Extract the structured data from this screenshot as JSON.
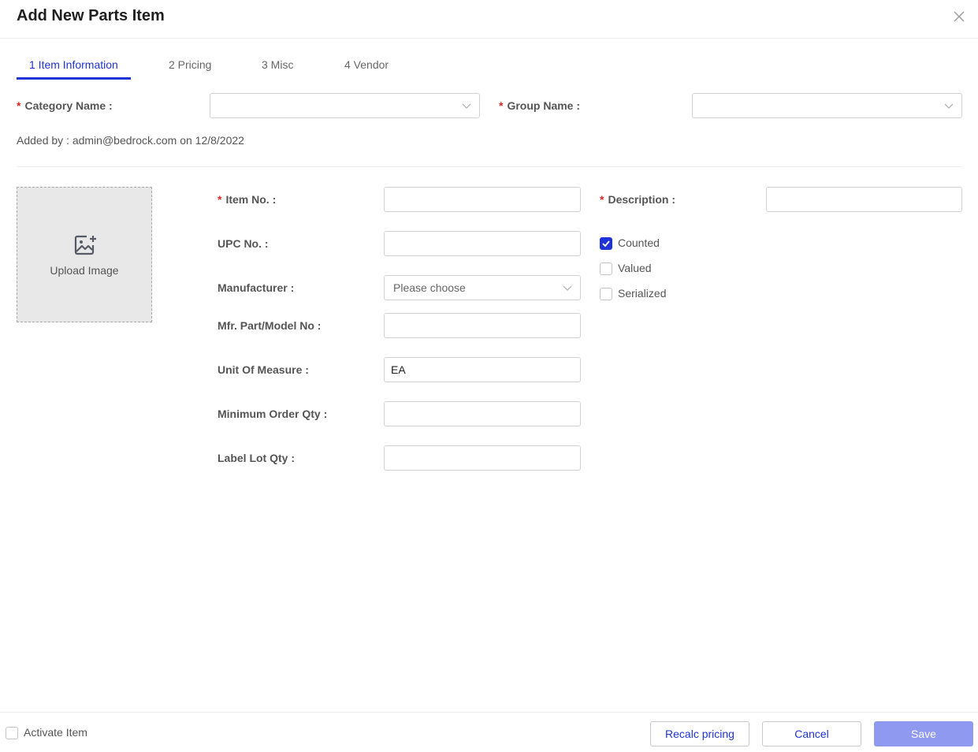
{
  "dialog": {
    "title": "Add New Parts Item"
  },
  "tabs": [
    {
      "label": "1 Item Information",
      "active": true
    },
    {
      "label": "2 Pricing",
      "active": false
    },
    {
      "label": "3 Misc",
      "active": false
    },
    {
      "label": "4 Vendor",
      "active": false
    }
  ],
  "top_fields": {
    "category_label": "Category Name",
    "category_value": "",
    "group_label": "Group Name",
    "group_value": ""
  },
  "added_by": "Added by : admin@bedrock.com on 12/8/2022",
  "upload": {
    "label": "Upload Image",
    "icon": "image-add-icon"
  },
  "form": {
    "item_no": {
      "label": "Item No.",
      "value": ""
    },
    "upc_no": {
      "label": "UPC No.",
      "value": ""
    },
    "manufacturer": {
      "label": "Manufacturer",
      "placeholder": "Please choose"
    },
    "mfr_part": {
      "label": "Mfr. Part/Model No",
      "value": ""
    },
    "unit_of_measure": {
      "label": "Unit Of Measure",
      "value": "EA"
    },
    "min_order_qty": {
      "label": "Minimum Order Qty",
      "value": ""
    },
    "label_lot_qty": {
      "label": "Label Lot Qty",
      "value": ""
    },
    "description": {
      "label": "Description",
      "value": ""
    }
  },
  "checkboxes": [
    {
      "label": "Counted",
      "checked": true
    },
    {
      "label": "Valued",
      "checked": false
    },
    {
      "label": "Serialized",
      "checked": false
    }
  ],
  "footer": {
    "activate_label": "Activate Item",
    "activate_checked": false,
    "recalc_label": "Recalc pricing",
    "cancel_label": "Cancel",
    "save_label": "Save"
  },
  "colors": {
    "accent": "#1f33d6",
    "required": "#e02424",
    "save_disabled": "#8f99ef"
  }
}
